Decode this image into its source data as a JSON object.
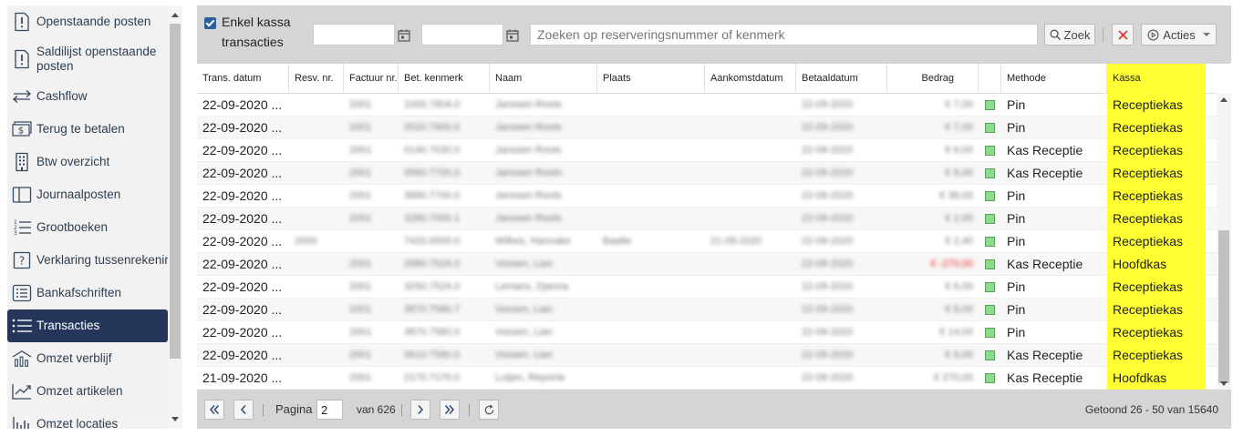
{
  "sidebar": {
    "items": [
      {
        "label": "Openstaande posten",
        "icon": "exclamation-doc-icon",
        "active": false
      },
      {
        "label": "Saldilijst openstaande posten",
        "icon": "exclamation-doc-icon",
        "active": false
      },
      {
        "label": "Cashflow",
        "icon": "arrows-exchange-icon",
        "active": false
      },
      {
        "label": "Terug te betalen",
        "icon": "cash-return-icon",
        "active": false
      },
      {
        "label": "Btw overzicht",
        "icon": "building-icon",
        "active": false
      },
      {
        "label": "Journaalposten",
        "icon": "book-icon",
        "active": false
      },
      {
        "label": "Grootboeken",
        "icon": "numbered-list-icon",
        "active": false
      },
      {
        "label": "Verklaring tussenrekening",
        "icon": "question-box-icon",
        "active": false
      },
      {
        "label": "Bankafschriften",
        "icon": "list-box-icon",
        "active": false
      },
      {
        "label": "Transacties",
        "icon": "bullet-list-icon",
        "active": true
      },
      {
        "label": "Omzet verblijf",
        "icon": "house-chart-icon",
        "active": false
      },
      {
        "label": "Omzet artikelen",
        "icon": "trend-chart-icon",
        "active": false
      },
      {
        "label": "Omzet locaties",
        "icon": "bar-chart-icon",
        "active": false
      }
    ]
  },
  "toolbar": {
    "single_register_label": "Enkel kassa transacties",
    "single_register_checked": true,
    "date_from": "",
    "date_to": "",
    "search_placeholder": "Zoeken op reserveringsnummer of kenmerk",
    "search_button": "Zoek",
    "clear_icon": "close-icon",
    "actions_button": "Acties"
  },
  "grid": {
    "columns": [
      "Trans. datum",
      "Resv. nr.",
      "Factuur nr.",
      "Bet. kenmerk",
      "Naam",
      "Plaats",
      "Aankomstdatum",
      "Betaaldatum",
      "Bedrag",
      "",
      "Methode",
      "Kassa"
    ],
    "rows": [
      {
        "date": "22-09-2020 ...",
        "resv": "",
        "invoice": "2001",
        "ref": "1000.7804.0",
        "name": "Janssen Roots",
        "place": "",
        "arrival": "",
        "paid": "22-09-2020",
        "amount": "€ 7,00",
        "negative": false,
        "method": "Pin",
        "register": "Receptiekas"
      },
      {
        "date": "22-09-2020 ...",
        "resv": "",
        "invoice": "2001",
        "ref": "0520.7800.0",
        "name": "Janssen Roots",
        "place": "",
        "arrival": "",
        "paid": "22-09-2020",
        "amount": "€ 7,00",
        "negative": false,
        "method": "Pin",
        "register": "Receptiekas"
      },
      {
        "date": "22-09-2020 ...",
        "resv": "",
        "invoice": "2001",
        "ref": "0140.7030.0",
        "name": "Janssen Roots",
        "place": "",
        "arrival": "",
        "paid": "22-09-2020",
        "amount": "€ 6,00",
        "negative": false,
        "method": "Kas Receptie",
        "register": "Receptiekas"
      },
      {
        "date": "22-09-2020 ...",
        "resv": "",
        "invoice": "2001",
        "ref": "0560.7700.0",
        "name": "Janssen Roots",
        "place": "",
        "arrival": "",
        "paid": "22-09-2020",
        "amount": "€ 8,00",
        "negative": false,
        "method": "Kas Receptie",
        "register": "Receptiekas"
      },
      {
        "date": "22-09-2020 ...",
        "resv": "",
        "invoice": "2001",
        "ref": "3880.7700.0",
        "name": "Janssen Roots",
        "place": "",
        "arrival": "",
        "paid": "22-09-2020",
        "amount": "€ 38,00",
        "negative": false,
        "method": "Pin",
        "register": "Receptiekas"
      },
      {
        "date": "22-09-2020 ...",
        "resv": "",
        "invoice": "2001",
        "ref": "3280.7000.1",
        "name": "Janssen Roots",
        "place": "",
        "arrival": "",
        "paid": "22-09-2020",
        "amount": "€ 2,00",
        "negative": false,
        "method": "Pin",
        "register": "Receptiekas"
      },
      {
        "date": "22-09-2020 ...",
        "resv": "2000",
        "invoice": "",
        "ref": "7420.0000.0",
        "name": "Wilkes, Hannake",
        "place": "Baalte",
        "arrival": "21-09-2020",
        "paid": "22-09-2020",
        "amount": "€ 2,40",
        "negative": false,
        "method": "Pin",
        "register": "Receptiekas"
      },
      {
        "date": "22-09-2020 ...",
        "resv": "",
        "invoice": "2001",
        "ref": "2880.7524.0",
        "name": "Vossen, Lian",
        "place": "",
        "arrival": "",
        "paid": "22-09-2020",
        "amount": "€ -270,00",
        "negative": true,
        "method": "Kas Receptie",
        "register": "Hoofdkas"
      },
      {
        "date": "22-09-2020 ...",
        "resv": "",
        "invoice": "2001",
        "ref": "3250.7524.0",
        "name": "Lemans, Djanna",
        "place": "",
        "arrival": "",
        "paid": "22-09-2020",
        "amount": "€ 6,00",
        "negative": false,
        "method": "Pin",
        "register": "Receptiekas"
      },
      {
        "date": "22-09-2020 ...",
        "resv": "",
        "invoice": "2001",
        "ref": "3870.7580.7",
        "name": "Vossen, Lian",
        "place": "",
        "arrival": "",
        "paid": "22-09-2020",
        "amount": "€ 6,00",
        "negative": false,
        "method": "Pin",
        "register": "Receptiekas"
      },
      {
        "date": "22-09-2020 ...",
        "resv": "",
        "invoice": "2001",
        "ref": "3870.7580.0",
        "name": "Vossen, Lian",
        "place": "",
        "arrival": "",
        "paid": "22-09-2020",
        "amount": "€ 14,00",
        "negative": false,
        "method": "Pin",
        "register": "Receptiekas"
      },
      {
        "date": "22-09-2020 ...",
        "resv": "",
        "invoice": "2001",
        "ref": "0610.7580.0",
        "name": "Vossen, Lian",
        "place": "",
        "arrival": "",
        "paid": "22-09-2020",
        "amount": "€ 6,00",
        "negative": false,
        "method": "Kas Receptie",
        "register": "Receptiekas"
      },
      {
        "date": "21-09-2020 ...",
        "resv": "",
        "invoice": "2001",
        "ref": "2170.7170.0",
        "name": "Lutjen, Reyonie",
        "place": "",
        "arrival": "",
        "paid": "22-09-2020",
        "amount": "€ 270,00",
        "negative": false,
        "method": "Kas Receptie",
        "register": "Hoofdkas"
      }
    ]
  },
  "pager": {
    "page_label": "Pagina",
    "page_value": "2",
    "of_label": "van 626",
    "summary": "Getoond 26 - 50 van 15640"
  },
  "colors": {
    "sidebar_active": "#24375a",
    "kassa_highlight": "#ffff33",
    "status_green": "#8ddc8d",
    "negative_amount": "#e22222",
    "checkbox": "#2d5f9a"
  }
}
